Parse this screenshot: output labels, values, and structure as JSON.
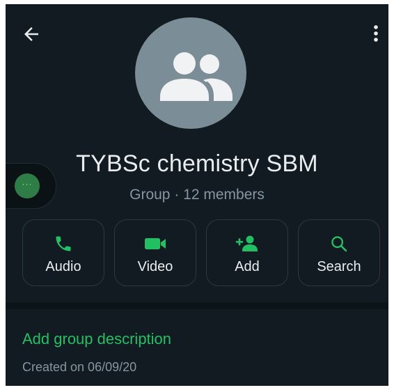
{
  "header": {
    "back_icon": "arrow-left-icon",
    "menu_icon": "more-vertical-icon",
    "avatar_icon": "group-people-icon"
  },
  "group": {
    "name": "TYBSc chemistry SBM",
    "meta": "Group · 12 members"
  },
  "floating_bubble": {
    "icon": "chat-bubble-dots-icon",
    "dots": "···"
  },
  "actions": [
    {
      "label": "Audio",
      "icon": "phone-icon"
    },
    {
      "label": "Video",
      "icon": "video-camera-icon"
    },
    {
      "label": "Add",
      "icon": "add-person-icon"
    },
    {
      "label": "Search",
      "icon": "search-icon"
    }
  ],
  "description": {
    "add_label": "Add group description",
    "created": "Created on 06/09/20"
  },
  "colors": {
    "background": "#121b22",
    "accent": "#21c063",
    "text_primary": "#e9edef",
    "text_secondary": "#8696a0",
    "avatar": "#7b8d96"
  }
}
